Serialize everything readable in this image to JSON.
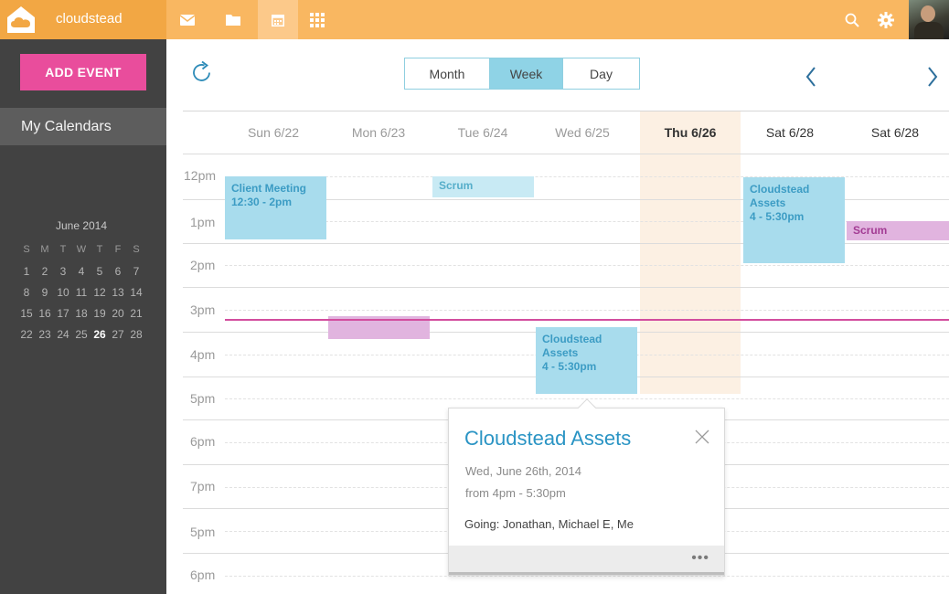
{
  "app": {
    "name": "cloudstead"
  },
  "sidebar": {
    "add_event_label": "ADD EVENT",
    "my_calendars_label": "My Calendars",
    "mini_calendar": {
      "title": "June 2014",
      "weekdays": [
        "S",
        "M",
        "T",
        "W",
        "T",
        "F",
        "S"
      ],
      "weeks": [
        [
          "1",
          "2",
          "3",
          "4",
          "5",
          "6",
          "7"
        ],
        [
          "8",
          "9",
          "10",
          "11",
          "12",
          "13",
          "14"
        ],
        [
          "15",
          "16",
          "17",
          "18",
          "19",
          "20",
          "21"
        ],
        [
          "22",
          "23",
          "24",
          "25",
          "26",
          "27",
          "28"
        ]
      ],
      "today": "26"
    }
  },
  "topbar": {
    "icons": [
      "mail-icon",
      "folder-icon",
      "calendar-icon",
      "apps-grid-icon",
      "search-icon",
      "gear-icon"
    ],
    "active_icon": "calendar-icon"
  },
  "toolbar": {
    "views": [
      "Month",
      "Week",
      "Day"
    ],
    "active_view": "Week"
  },
  "calendar": {
    "days": [
      "Sun 6/22",
      "Mon 6/23",
      "Tue 6/24",
      "Wed 6/25",
      "Thu 6/26",
      "Sat 6/28",
      "Sat 6/28"
    ],
    "today": "Thu 6/26",
    "times": [
      "12pm",
      "1pm",
      "2pm",
      "3pm",
      "4pm",
      "5pm",
      "6pm",
      "7pm",
      "5pm",
      "6pm"
    ],
    "events": [
      {
        "title": "Client Meeting",
        "time": "12:30 - 2pm",
        "color": "blue"
      },
      {
        "title": "Scrum",
        "time": "",
        "color": "lightblue"
      },
      {
        "title": "",
        "time": "",
        "color": "pink"
      },
      {
        "title": "Cloudstead Assets",
        "time": "4 - 5:30pm",
        "color": "blue"
      },
      {
        "title": "Cloudstead Assets",
        "time": "4 - 5:30pm",
        "color": "blue"
      },
      {
        "title": "Scrum",
        "time": "",
        "color": "pink"
      }
    ]
  },
  "popover": {
    "title": "Cloudstead Assets",
    "date": "Wed, June 26th, 2014",
    "time": "from 4pm - 5:30pm",
    "going": "Going: Jonathan, Michael E, Me",
    "more": "•••"
  },
  "colors": {
    "accent_orange": "#f9b761",
    "brand_orange": "#f2a744",
    "add_event_pink": "#e94d9c",
    "sidebar_bg": "#424242",
    "event_blue": "#a8dced",
    "event_pink": "#e1b4df",
    "now_line": "#d24d9e"
  }
}
